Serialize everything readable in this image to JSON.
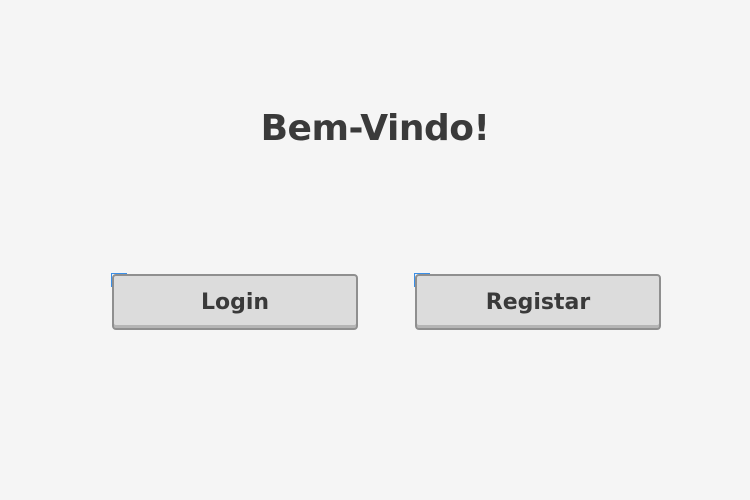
{
  "page": {
    "title": "Bem-Vindo!"
  },
  "actions": {
    "login_label": "Login",
    "register_label": "Registar"
  },
  "icons": {
    "link_badge": "link-swap-icon"
  },
  "colors": {
    "background": "#f5f5f5",
    "text": "#3a3a3a",
    "button_fill": "#dcdcdc",
    "button_border": "#8f8f8f",
    "badge": "#3a8ee6"
  }
}
